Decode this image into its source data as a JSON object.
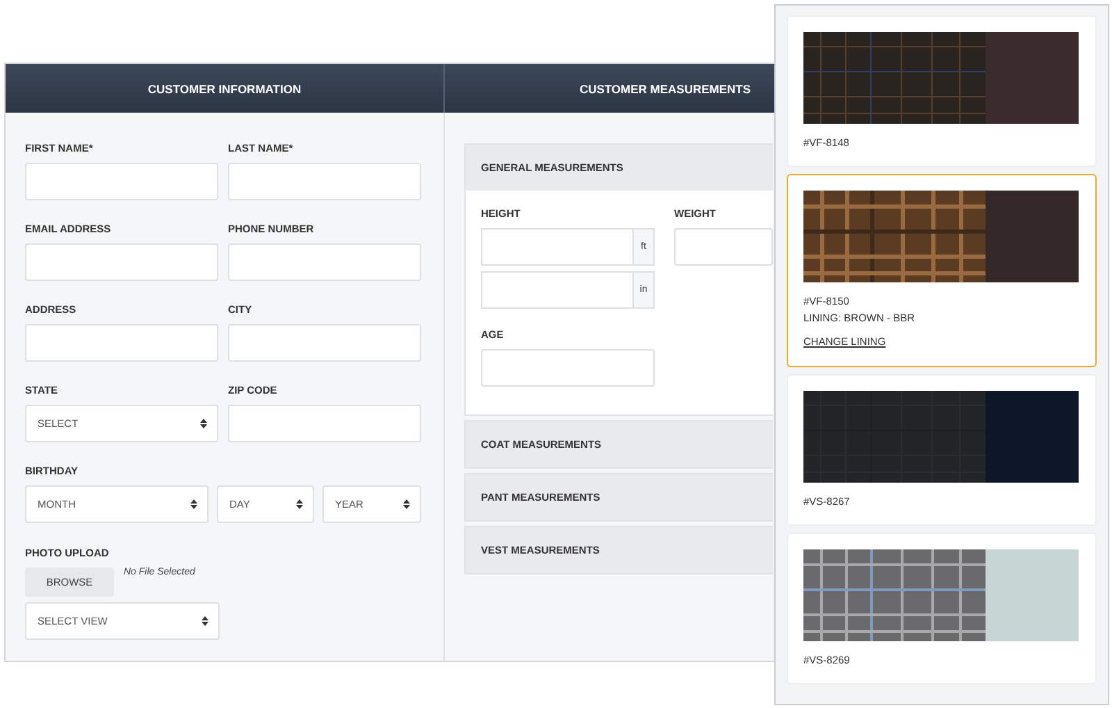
{
  "customer_information": {
    "title": "CUSTOMER INFORMATION",
    "rows": [
      [
        {
          "label": "FIRST NAME*",
          "kind": "text"
        },
        {
          "label": "LAST NAME*",
          "kind": "text"
        }
      ],
      [
        {
          "label": "EMAIL ADDRESS",
          "kind": "text"
        },
        {
          "label": "PHONE NUMBER",
          "kind": "text"
        }
      ],
      [
        {
          "label": "ADDRESS",
          "kind": "text"
        },
        {
          "label": "CITY",
          "kind": "text"
        }
      ],
      [
        {
          "label": "STATE",
          "kind": "select",
          "value": "SELECT"
        },
        {
          "label": "ZIP CODE",
          "kind": "text"
        }
      ]
    ],
    "birthday": {
      "label": "BIRTHDAY",
      "selects": [
        "MONTH",
        "DAY",
        "YEAR"
      ]
    },
    "photo_upload": {
      "label": "PHOTO UPLOAD",
      "button": "BROWSE",
      "file_status": "No File Selected",
      "view_select": "SELECT VIEW"
    }
  },
  "customer_measurements": {
    "title": "CUSTOMER MEASUREMENTS",
    "sections": [
      {
        "title": "GENERAL MEASUREMENTS",
        "expanded": true
      },
      {
        "title": "COAT MEASUREMENTS",
        "expanded": false
      },
      {
        "title": "PANT MEASUREMENTS",
        "expanded": false
      },
      {
        "title": "VEST MEASUREMENTS",
        "expanded": false
      }
    ],
    "height": {
      "label": "HEIGHT",
      "units": [
        "ft",
        "in"
      ]
    },
    "weight": {
      "label": "WEIGHT"
    },
    "age": {
      "label": "AGE"
    }
  },
  "fabrics": [
    {
      "code": "#VF-8148",
      "selected": false,
      "color": "#3a2c2c"
    },
    {
      "code": "#VF-8150",
      "lining": "LINING: BROWN - BBR",
      "action": "CHANGE LINING",
      "selected": true,
      "color": "#352828"
    },
    {
      "code": "#VS-8267",
      "selected": false,
      "color": "#0d1729"
    },
    {
      "code": "#VS-8269",
      "selected": false,
      "color": "#c7d5d5"
    }
  ]
}
